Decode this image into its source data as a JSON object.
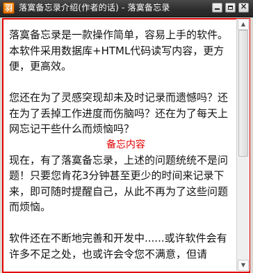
{
  "window": {
    "title": "落寞备忘录介绍(作者的话) - 落寞备忘录",
    "icon_glyph": "羽",
    "minimize_label": "_",
    "close_glyph": "×"
  },
  "content": {
    "paragraphs": [
      "落寞备忘录是一款操作简单，容易上手的软件。本软件采用数据库+HTML代码读写内容，更方便，更高效。",
      "您还在为了灵感突现却未及时记录而遗憾吗？还在为了丢掉工作进度而伤脑吗？还在为了每天上网忘记干些什么而烦恼吗？",
      "现在，有了落寞备忘录，上述的问题统统不是问题！只要您肯花3分钟甚至更少的时间来记录下来，即可随时提醒自己，从此不再为了这些问题而烦恼。",
      "软件还在不断地完善和开发中......或许软件会有许多不足之处，也或许会令您不满意，但请"
    ],
    "annotation": "备忘内容"
  },
  "scrollbar": {
    "position_fraction": 0.0,
    "visible_fraction": 0.55
  },
  "colors": {
    "accent_border": "#e00000",
    "annotation_text": "#e00000",
    "title_bar": "#2e2e2e"
  }
}
